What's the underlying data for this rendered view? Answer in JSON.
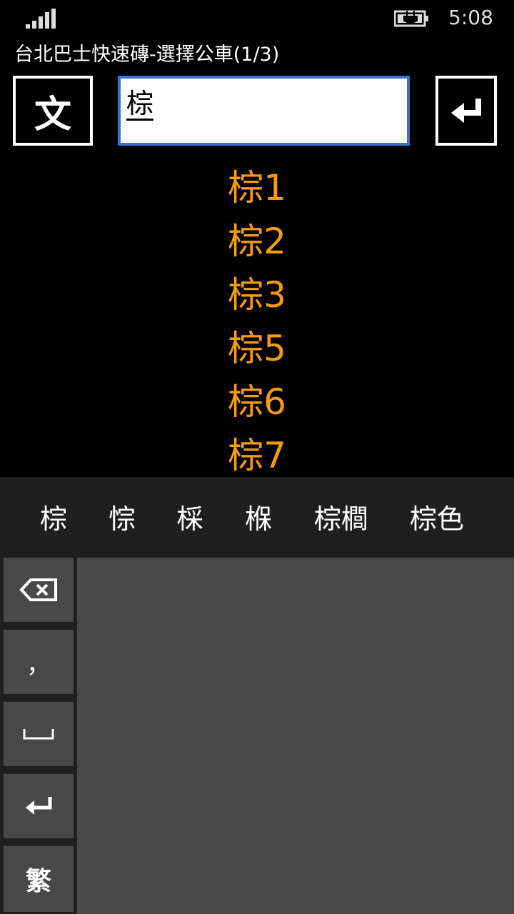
{
  "status": {
    "time": "5:08",
    "signal_icon": "signal-bars-icon",
    "battery_icon": "battery-charging-icon"
  },
  "app": {
    "title": "台北巴士快速磚-選擇公車(1/3)"
  },
  "toolbar": {
    "lang_label": "文",
    "search_value": "棕",
    "enter_icon": "enter-icon"
  },
  "routes": [
    "棕1",
    "棕2",
    "棕3",
    "棕5",
    "棕6",
    "棕7"
  ],
  "candidates": [
    "棕",
    "悰",
    "棌",
    "椺",
    "棕櫚",
    "棕色"
  ],
  "keyboard": {
    "backspace_icon": "backspace-icon",
    "comma": "，",
    "space_icon": "space-icon",
    "enter_icon": "enter-icon",
    "mode_label": "繁"
  },
  "colors": {
    "route_text": "#f39c12",
    "search_border": "#3a6fd8",
    "key_bg": "#484848"
  }
}
